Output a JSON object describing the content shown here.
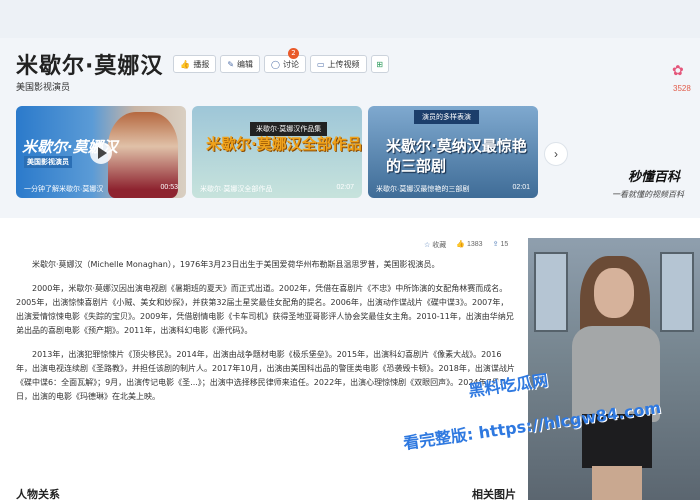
{
  "header": {
    "name": "米歇尔·莫娜汉",
    "subtitle": "美国影视演员",
    "actions": [
      {
        "icon": "thumbs-up-icon",
        "label": "播报"
      },
      {
        "icon": "edit-icon",
        "label": "编辑"
      },
      {
        "icon": "comment-icon",
        "label": "讨论",
        "badge": "2"
      },
      {
        "icon": "upload-icon",
        "label": "上传视频"
      }
    ],
    "flower_count": "3528"
  },
  "videos": [
    {
      "overlay": "米歇尔·莫娜汉",
      "overlay_sub": "美国影视演员",
      "caption": "一分钟了解米歇尔·莫娜汉",
      "duration": "00:53"
    },
    {
      "tag": "米歇尔·莫娜汉作品集",
      "overlay": "米歇尔·莫娜汉全部作品",
      "caption": "米歇尔·莫娜汉全部作品",
      "duration": "02:07"
    },
    {
      "tag": "演员的多样表演",
      "overlay": "米歇尔·莫纳汉最惊艳的三部剧",
      "caption": "米歇尔·莫娜汉最惊艳的三部剧",
      "duration": "02:01"
    }
  ],
  "brand": {
    "name": "秒懂百科",
    "slogan": "一看就懂的视频百科"
  },
  "stats": {
    "collect_label": "收藏",
    "collect_count": "1383",
    "like_count": "15"
  },
  "article": {
    "p1": "米歇尔·莫娜汉（Michelle Monaghan），1976年3月23日出生于美国爱荷华州布勒斯县温思罗普，美国影视演员。",
    "p2": "2000年，米歇尔·莫娜汉因出演电视剧《暑期班的夏天》而正式出道。2002年，凭借在喜剧片《不忠》中所饰演的女配角林赛而成名。2005年，出演惊悚喜剧片《小贼、美女和妙探》，并获第32届土星奖最佳女配角的提名。2006年，出演动作谍战片《碟中谍3》。2007年，出演爱情惊悚电影《失踪的宝贝》。2009年，凭借剧情电影《卡车司机》获得圣地亚哥影评人协会奖最佳女主角。2010-11年，出演由华纳兄弟出品的喜剧电影《预产期》。2011年，出演科幻电影《源代码》。",
    "p3": "2013年，出演犯罪惊悚片《顶尖移民》。2014年，出演由战争题材电影《极乐堡垒》。2015年，出演科幻喜剧片《像素大战》。2016年，出演电视连续剧《圣路教》，并担任该剧的制片人。2017年10月，出演由美国科出品的警匪类电影《恐袭毁卡顿》。2018年，出演谍战片《碟中谍6：全面瓦解》；9月，出演传记电影《圣...》；出演中选择移民律师来追任。2022年，出演心理惊悚剧《双眼回声》。2024年7月5日，出演的电影《玛德琳》在北美上映。"
  },
  "bottom": {
    "left_heading": "人物关系",
    "right_heading": "相关图片"
  },
  "watermarks": {
    "line1": "黑料吃瓜网",
    "line2": "看完整版: https://hlcgw84.com"
  }
}
